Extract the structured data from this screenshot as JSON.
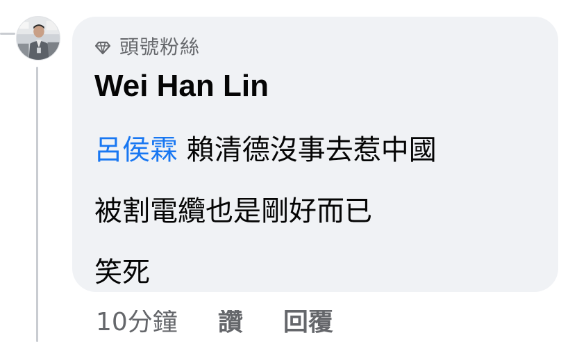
{
  "comment": {
    "badge_icon": "diamond-icon",
    "badge_label": "頭號粉絲",
    "author": "Wei Han Lin",
    "mention": "呂侯霖",
    "body_line1": "賴清德沒事去惹中國",
    "body_line2": "被割電纜也是剛好而已",
    "body_line3": "笑死"
  },
  "actions": {
    "timestamp": "10分鐘",
    "like": "讚",
    "reply": "回覆"
  },
  "colors": {
    "bubble": "#f0f2f5",
    "mention": "#1877f2",
    "secondary_text": "#65676b",
    "thread_line": "#c9ccd1"
  }
}
